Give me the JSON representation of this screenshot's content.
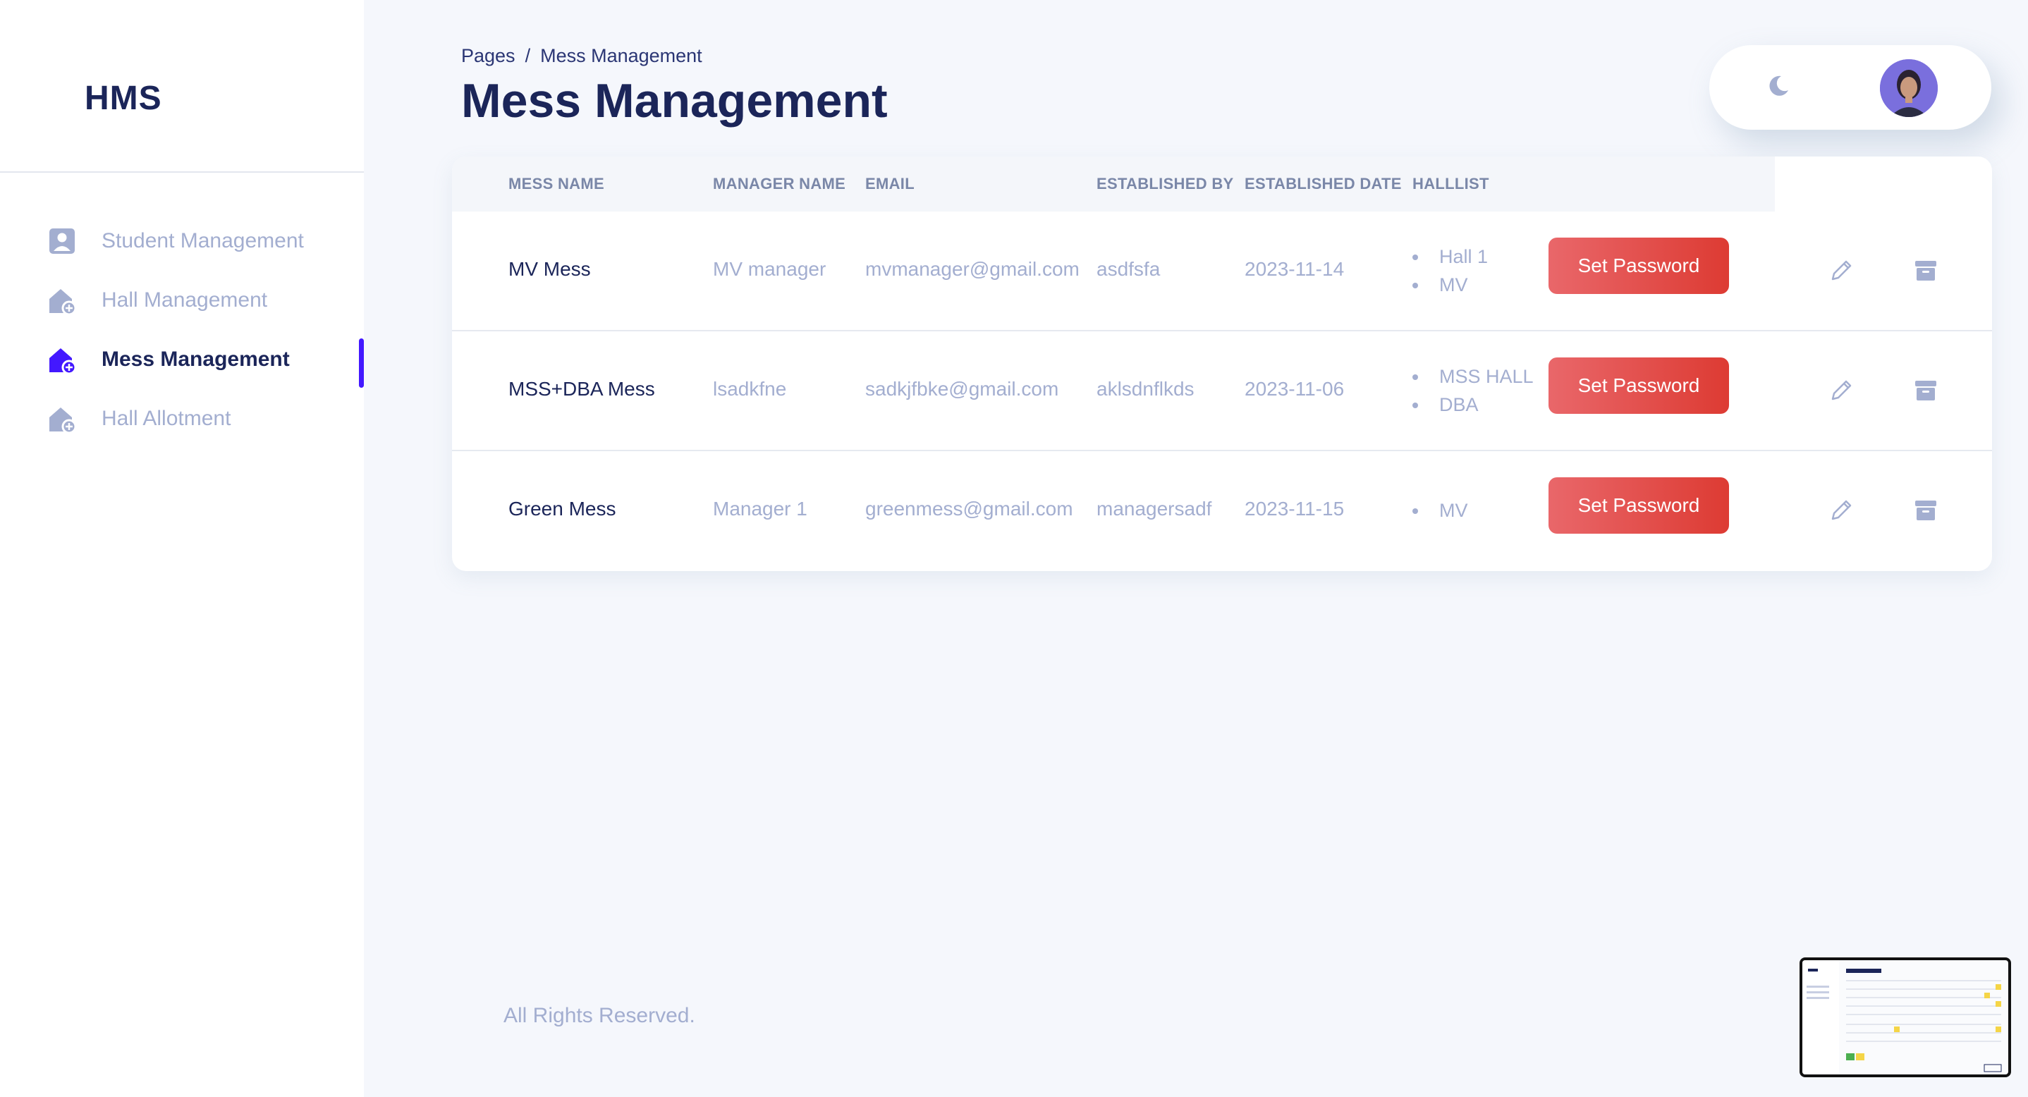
{
  "sidebar": {
    "brand": "HMS",
    "items": [
      {
        "label": "Student Management",
        "icon": "student-icon",
        "active": false
      },
      {
        "label": "Hall Management",
        "icon": "hall-icon",
        "active": false
      },
      {
        "label": "Mess Management",
        "icon": "mess-icon",
        "active": true
      },
      {
        "label": "Hall Allotment",
        "icon": "allotment-icon",
        "active": false
      }
    ]
  },
  "header": {
    "breadcrumb_root": "Pages",
    "breadcrumb_sep": "/",
    "breadcrumb_current": "Mess Management",
    "title": "Mess Management"
  },
  "table": {
    "columns": [
      "MESS NAME",
      "MANAGER NAME",
      "EMAIL",
      "ESTABLISHED BY",
      "ESTABLISHED DATE",
      "HALLLIST"
    ],
    "rows": [
      {
        "mess_name": "MV Mess",
        "manager": "MV manager",
        "email": "mvmanager@gmail.com",
        "established_by": "asdfsfa",
        "date": "2023-11-14",
        "halls": [
          "Hall 1",
          "MV"
        ],
        "button": "Set Password"
      },
      {
        "mess_name": "MSS+DBA Mess",
        "manager": "lsadkfne",
        "email": "sadkjfbke@gmail.com",
        "established_by": "aklsdnflkds",
        "date": "2023-11-06",
        "halls": [
          "MSS HALL",
          "DBA"
        ],
        "button": "Set Password"
      },
      {
        "mess_name": "Green Mess",
        "manager": "Manager 1",
        "email": "greenmess@gmail.com",
        "established_by": "managersadf",
        "date": "2023-11-15",
        "halls": [
          "MV"
        ],
        "button": "Set Password"
      }
    ]
  },
  "footer": {
    "text": "All Rights Reserved."
  },
  "colors": {
    "accent": "#4318FF",
    "button": "#DD3B33",
    "title": "#1B2559",
    "muted": "#A3AED0"
  }
}
